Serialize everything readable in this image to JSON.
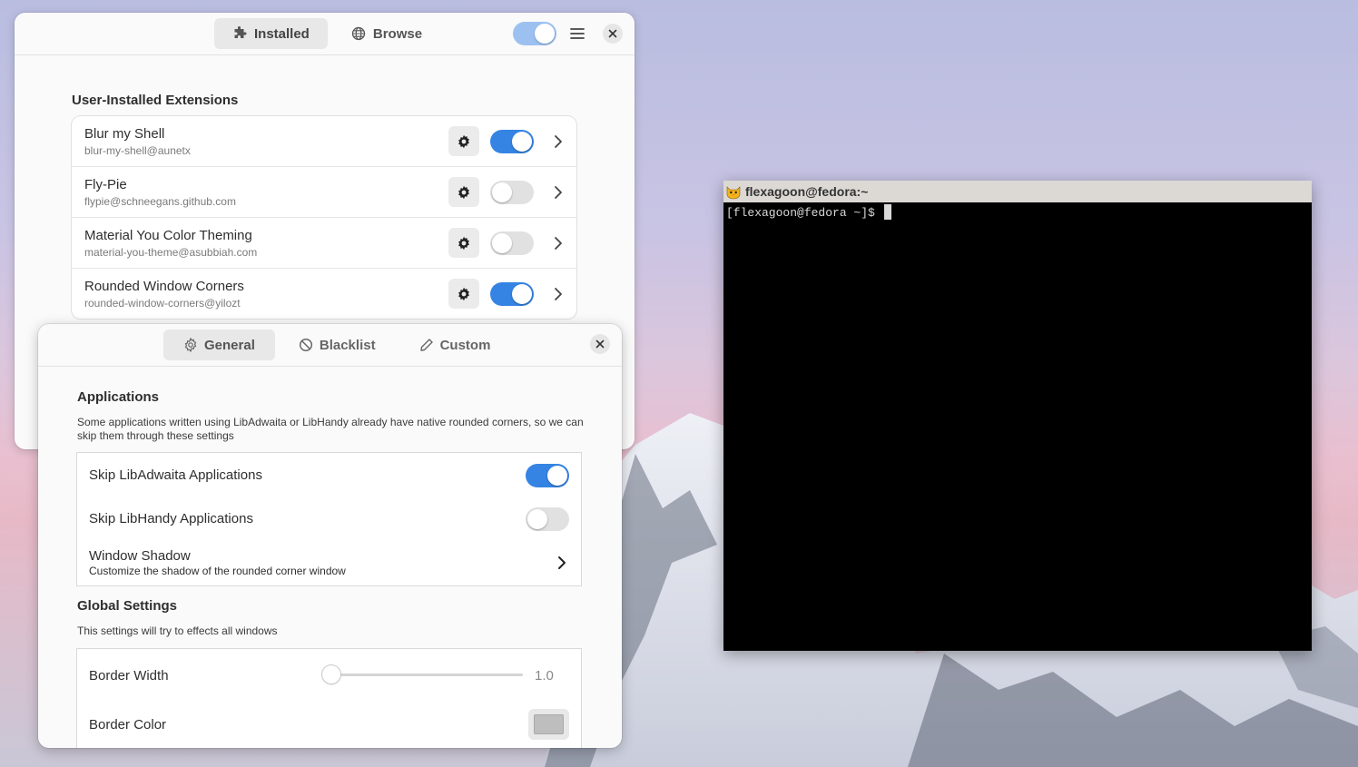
{
  "extensions_app": {
    "tabs": [
      {
        "label": "Installed",
        "icon": "puzzle-icon",
        "active": true
      },
      {
        "label": "Browse",
        "icon": "globe-icon",
        "active": false
      }
    ],
    "extensions_enabled": true,
    "section_title": "User-Installed Extensions",
    "extensions": [
      {
        "name": "Blur my Shell",
        "uuid": "blur-my-shell@aunetx",
        "enabled": true
      },
      {
        "name": "Fly-Pie",
        "uuid": "flypie@schneegans.github.com",
        "enabled": false
      },
      {
        "name": "Material You Color Theming",
        "uuid": "material-you-theme@asubbiah.com",
        "enabled": false
      },
      {
        "name": "Rounded Window Corners",
        "uuid": "rounded-window-corners@yilozt",
        "enabled": true
      }
    ]
  },
  "prefs_window": {
    "tabs": [
      {
        "label": "General",
        "icon": "gear-icon",
        "active": true
      },
      {
        "label": "Blacklist",
        "icon": "block-icon",
        "active": false
      },
      {
        "label": "Custom",
        "icon": "pencil-icon",
        "active": false
      }
    ],
    "applications": {
      "title": "Applications",
      "description": "Some applications written using LibAdwaita or LibHandy already have native rounded corners, so we can skip them through these settings",
      "skip_libadwaita": {
        "label": "Skip LibAdwaita Applications",
        "enabled": true
      },
      "skip_libhandy": {
        "label": "Skip LibHandy Applications",
        "enabled": false
      },
      "window_shadow": {
        "label": "Window Shadow",
        "subtitle": "Customize the shadow of the rounded corner window"
      }
    },
    "global": {
      "title": "Global Settings",
      "description": "This settings will try to effects all windows",
      "border_width": {
        "label": "Border Width",
        "value": "1.0"
      },
      "border_color": {
        "label": "Border Color",
        "color": "#bebebe"
      }
    }
  },
  "terminal": {
    "title": "flexagoon@fedora:~",
    "prompt": "[flexagoon@fedora ~]$ "
  },
  "colors": {
    "accent": "#3584e4"
  }
}
